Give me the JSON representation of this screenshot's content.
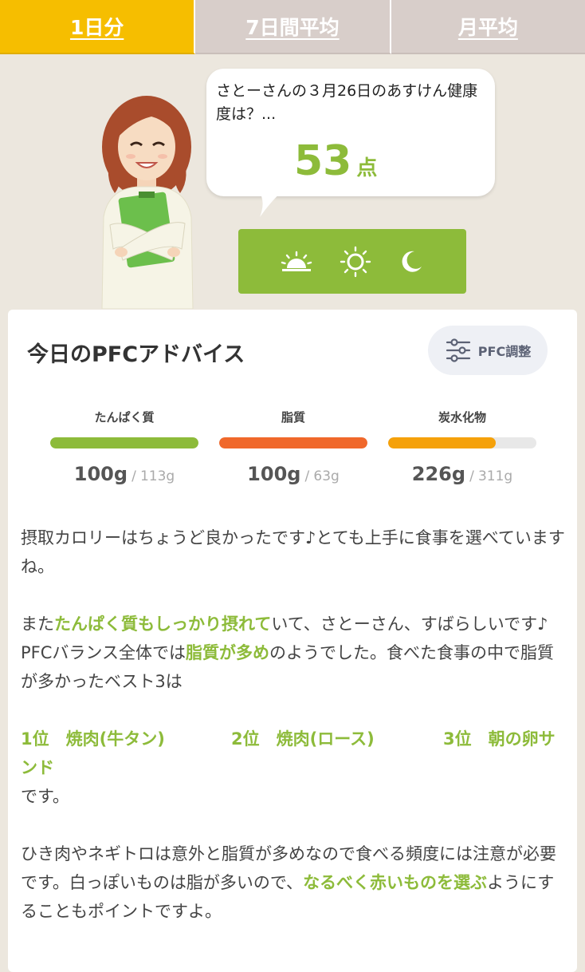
{
  "tabs": [
    {
      "label": "1日分",
      "active": true
    },
    {
      "label": "7日間平均",
      "active": false
    },
    {
      "label": "月平均",
      "active": false
    }
  ],
  "bubble": {
    "text": "さとーさんの３月26日のあすけん健康度は？...",
    "score": "53",
    "score_unit": "点"
  },
  "time_icons": [
    "sunrise-icon",
    "sun-icon",
    "moon-icon"
  ],
  "card": {
    "title": "今日のPFCアドバイス",
    "pfc_button": "PFC調整"
  },
  "nutrients": [
    {
      "label": "たんぱく質",
      "amount": "100g",
      "target": "113g",
      "fill": 1.0,
      "color": "#8dbb3a"
    },
    {
      "label": "脂質",
      "amount": "100g",
      "target": "63g",
      "fill": 1.0,
      "color": "#f0682b"
    },
    {
      "label": "炭水化物",
      "amount": "226g",
      "target": "311g",
      "fill": 0.727,
      "color": "#f5a10a"
    }
  ],
  "nutrient_separator": "/",
  "advice": {
    "p1": "摂取カロリーはちょうど良かったです♪とても上手に食事を選べていますね。",
    "p2_a": "また",
    "p2_hl": "たんぱく質もしっかり摂れて",
    "p2_b": "いて、さとーさん、すばらしいです♪",
    "p3_a": "PFCバランス全体では",
    "p3_hl": "脂質が多め",
    "p3_b": "のようでした。食べた食事の中で脂質が多かったベスト3は",
    "rank1": "1位　焼肉(牛タン)",
    "rank2": "2位　焼肉(ロース)",
    "rank3": "3位　朝の卵サンド",
    "desu": "です。",
    "p5_a": "ひき肉やネギトロは意外と脂質が多めなので食べる頻度には注意が必要です。白っぽいものは脂が多いので、",
    "p5_hl": "なるべく赤いものを選ぶ",
    "p5_b": "ようにすることもポイントですよ。"
  },
  "colors": {
    "accent_green": "#8dbb3a",
    "tab_active": "#f6be00",
    "fat_orange": "#f0682b",
    "carb_orange": "#f5a10a"
  }
}
